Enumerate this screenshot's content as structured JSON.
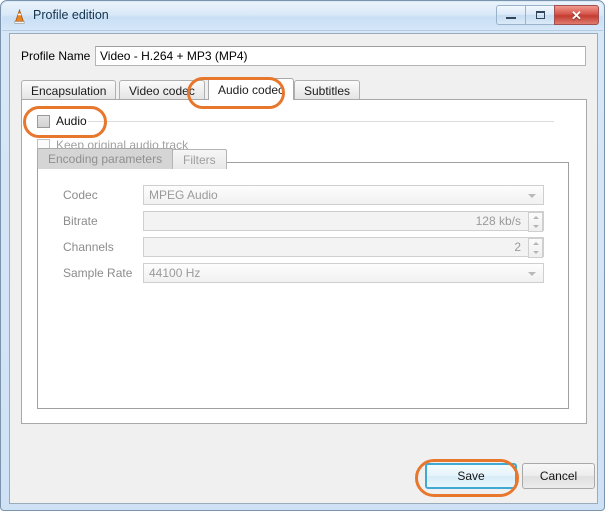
{
  "window": {
    "title": "Profile edition",
    "app_icon": "vlc-cone-icon",
    "controls": {
      "minimize": "minimize-icon",
      "maximize": "maximize-icon",
      "close": "✕"
    }
  },
  "profile_name": {
    "label": "Profile Name",
    "value": "Video - H.264 + MP3 (MP4)"
  },
  "tabs": [
    {
      "label": "Encapsulation",
      "active": false
    },
    {
      "label": "Video codec",
      "active": false
    },
    {
      "label": "Audio codec",
      "active": true
    },
    {
      "label": "Subtitles",
      "active": false
    }
  ],
  "audio": {
    "enable_label": "Audio",
    "enable_checked": false,
    "keep_original_label": "Keep original audio track",
    "keep_original_checked": false
  },
  "inner_tabs": [
    {
      "label": "Encoding parameters",
      "active": true
    },
    {
      "label": "Filters",
      "active": false
    }
  ],
  "fields": [
    {
      "label": "Codec",
      "value": "MPEG Audio",
      "control": "combo"
    },
    {
      "label": "Bitrate",
      "value": "128 kb/s",
      "control": "spin"
    },
    {
      "label": "Channels",
      "value": "2",
      "control": "spin"
    },
    {
      "label": "Sample Rate",
      "value": "44100 Hz",
      "control": "combo"
    }
  ],
  "buttons": {
    "save": "Save",
    "cancel": "Cancel"
  },
  "colors": {
    "annotation": "#e8772e",
    "default_button_focus": "#3fa9d4",
    "titlebar": "#cfe2f5"
  }
}
